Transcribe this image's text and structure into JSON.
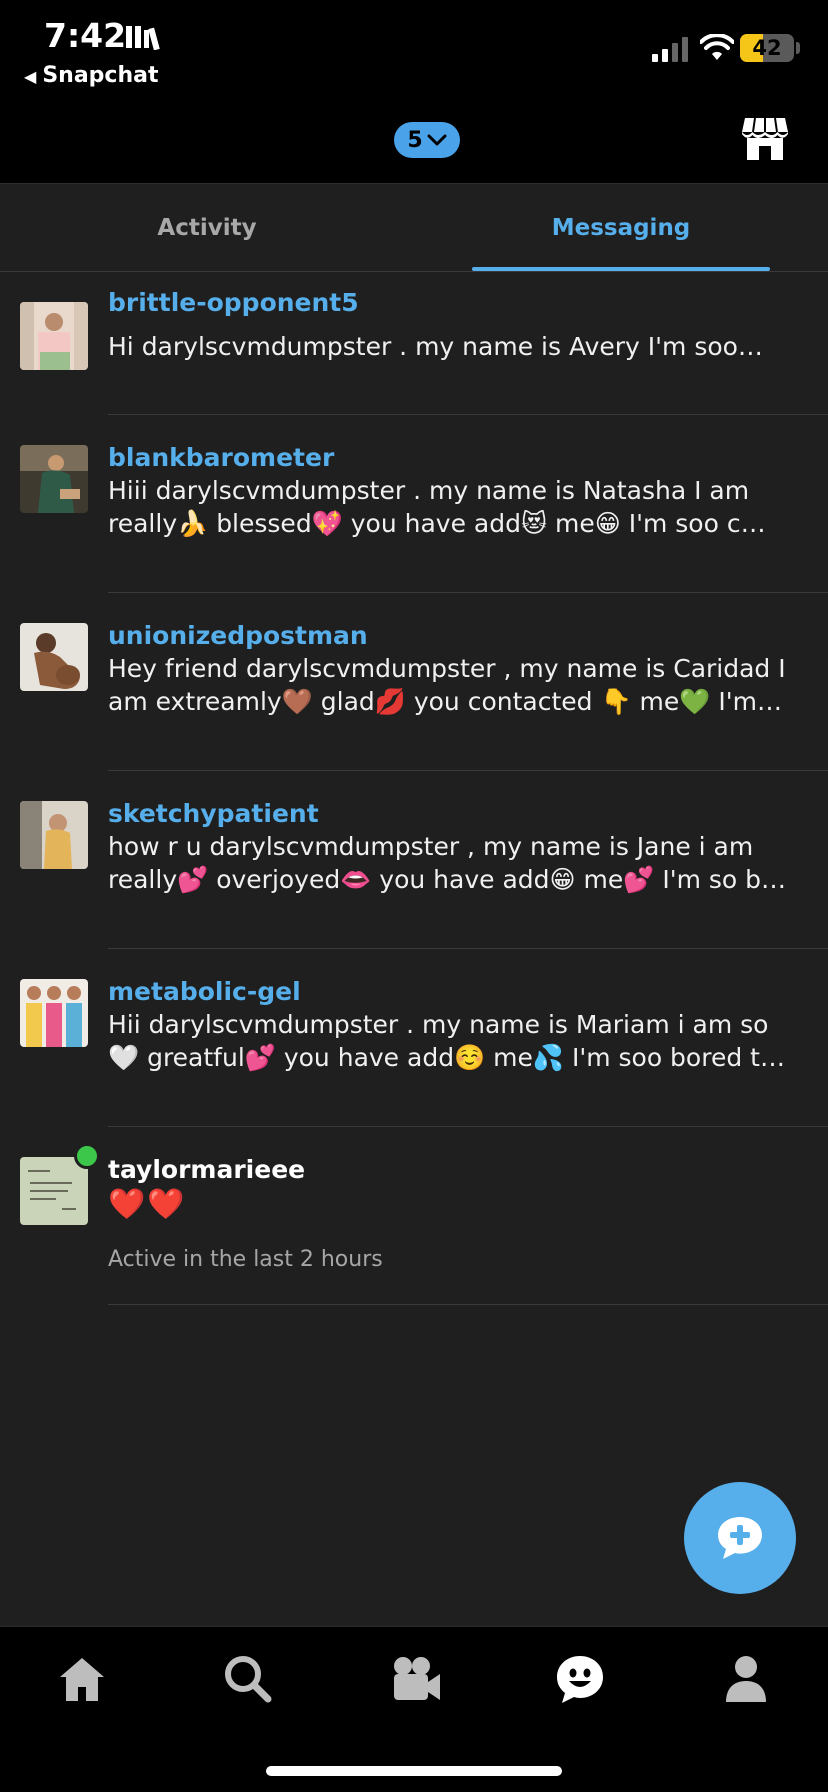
{
  "status_bar": {
    "time": "7:42",
    "back_app": "Snapchat",
    "battery_percent": "42",
    "battery_level": 0.42
  },
  "header": {
    "count_badge": "5"
  },
  "tabs": [
    {
      "label": "Activity",
      "active": false
    },
    {
      "label": "Messaging",
      "active": true
    }
  ],
  "conversations": [
    {
      "username": "brittle-opponent5",
      "line1": "Hi darylscvmdumpster . my name is Avery I'm soo…",
      "line2": ""
    },
    {
      "username": "blankbarometer",
      "line1": "Hiii darylscvmdumpster . my name is Natasha I am",
      "line2": "really🍌 blessed💖 you have add😻 me😁 I'm soo c…"
    },
    {
      "username": "unionizedpostman",
      "line1": "Hey friend darylscvmdumpster , my name is Caridad I",
      "line2": "am extreamly🤎 glad💋 you contacted 👇 me💚 I'm…"
    },
    {
      "username": "sketchypatient",
      "line1": "how r u darylscvmdumpster , my name is Jane i am",
      "line2": "really💕 overjoyed👄 you have add😁 me💕 I'm so b…"
    },
    {
      "username": "metabolic-gel",
      "line1": "Hii darylscvmdumpster . my name is Mariam i am so",
      "line2": "🤍 greatful💕 you have add☺️ me💦 I'm soo bored t…"
    },
    {
      "username": "taylormarieee",
      "message": "❤️❤️",
      "status": "Active in the last 2 hours",
      "online": true
    }
  ],
  "colors": {
    "accent": "#56aeea",
    "background": "#1f1f1f",
    "online": "#3cc64a",
    "battery": "#f5c518"
  },
  "nav_icons": [
    "home-icon",
    "search-icon",
    "video-camera-icon",
    "chat-face-icon",
    "profile-icon"
  ],
  "fab_icon": "new-message-icon"
}
